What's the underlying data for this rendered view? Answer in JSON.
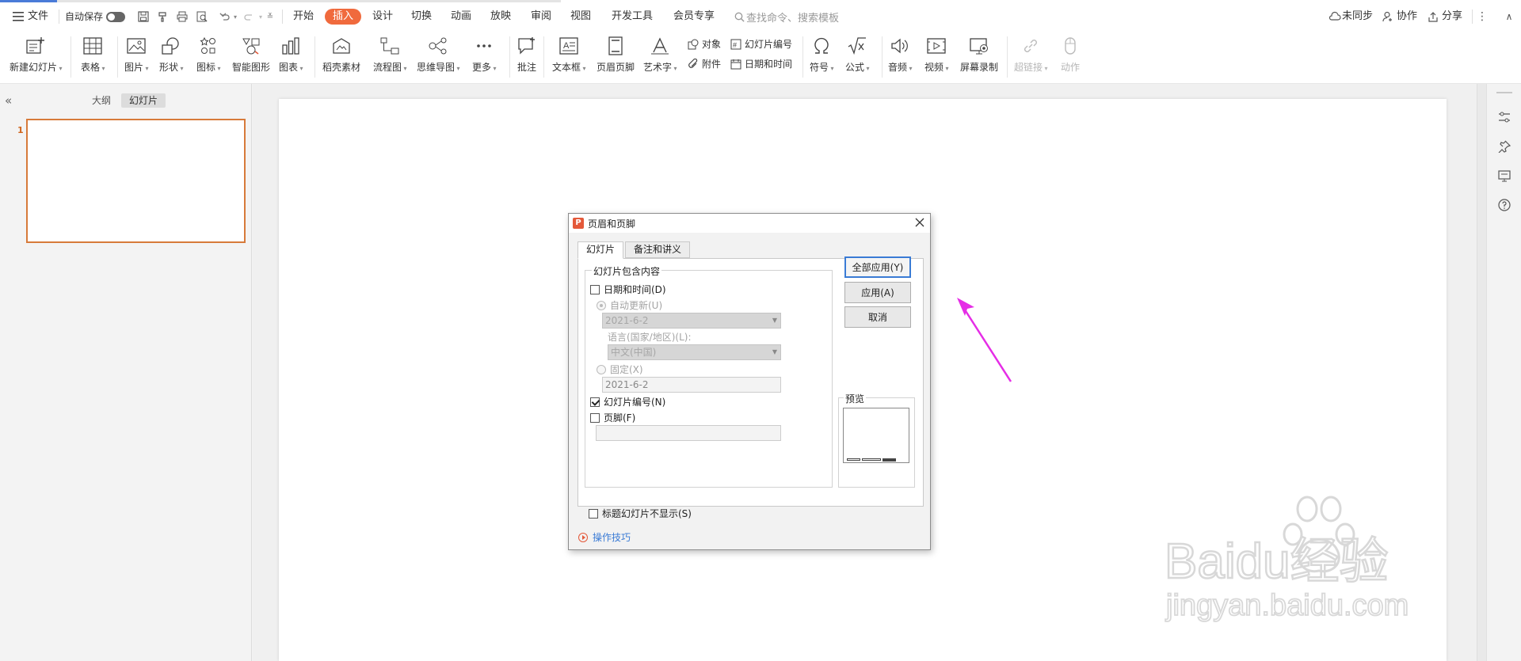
{
  "topbar": {
    "file": "文件",
    "autosave": "自动保存",
    "tabs": [
      "开始",
      "插入",
      "设计",
      "切换",
      "动画",
      "放映",
      "审阅",
      "视图",
      "开发工具",
      "会员专享"
    ],
    "active_tab_index": 1,
    "search_placeholder": "查找命令、搜索模板",
    "sync": "未同步",
    "collab": "协作",
    "share": "分享"
  },
  "ribbon": {
    "new_slide": "新建幻灯片",
    "table": "表格",
    "picture": "图片",
    "shape": "形状",
    "icon": "图标",
    "smart_graphic": "智能图形",
    "chart": "图表",
    "material": "稻壳素材",
    "flowchart": "流程图",
    "mindmap": "思维导图",
    "more": "更多",
    "comment": "批注",
    "textbox": "文本框",
    "header_footer": "页眉页脚",
    "wordart": "艺术字",
    "object": "对象",
    "attachment": "附件",
    "slide_number": "幻灯片编号",
    "datetime": "日期和时间",
    "symbol": "符号",
    "formula": "公式",
    "audio": "音频",
    "video": "视频",
    "screen_record": "屏幕录制",
    "hyperlink": "超链接",
    "action": "动作"
  },
  "left_panel": {
    "tab_outline": "大纲",
    "tab_slides": "幻灯片",
    "slide_number": "1"
  },
  "dialog": {
    "title": "页眉和页脚",
    "tab_slide": "幻灯片",
    "tab_notes": "备注和讲义",
    "group_label": "幻灯片包含内容",
    "datetime_label": "日期和时间(D)",
    "datetime_checked": false,
    "auto_update_label": "自动更新(U)",
    "auto_update_value": "2021-6-2",
    "language_label": "语言(国家/地区)(L):",
    "language_value": "中文(中国)",
    "fixed_label": "固定(X)",
    "fixed_value": "2021-6-2",
    "slide_number_label": "幻灯片编号(N)",
    "slide_number_checked": true,
    "footer_label": "页脚(F)",
    "footer_checked": false,
    "footer_value": "",
    "title_slide_label": "标题幻灯片不显示(S)",
    "title_slide_checked": false,
    "preview_label": "预览",
    "apply_all": "全部应用(Y)",
    "apply": "应用(A)",
    "cancel": "取消",
    "tips": "操作技巧"
  },
  "watermark": {
    "text1": "Baidu经验",
    "text2": "jingyan.baidu.com"
  },
  "colors": {
    "accent": "#f06a3d",
    "arrow": "#e52de6",
    "link": "#3a7bd5"
  }
}
